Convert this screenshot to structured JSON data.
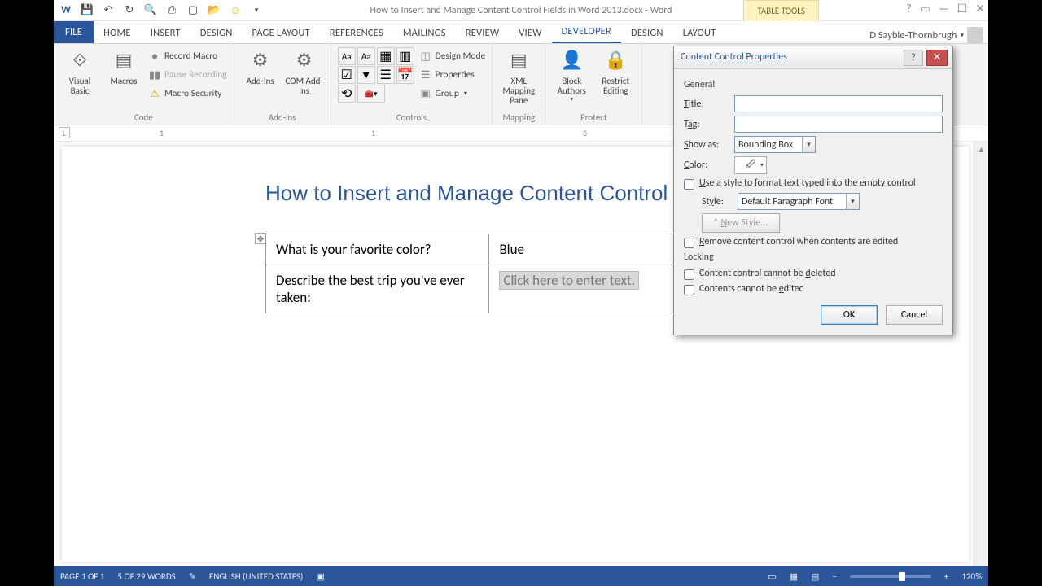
{
  "title": "How to Insert and Manage Content Control Fields in Word 2013.docx - Word",
  "context_tab": "TABLE TOOLS",
  "tabs": [
    "FILE",
    "HOME",
    "INSERT",
    "DESIGN",
    "PAGE LAYOUT",
    "REFERENCES",
    "MAILINGS",
    "REVIEW",
    "VIEW",
    "DEVELOPER",
    "DESIGN",
    "LAYOUT"
  ],
  "active_tab": "DEVELOPER",
  "user": "D Sayble-Thornbrugh",
  "ribbon": {
    "code": {
      "visual_basic": "Visual Basic",
      "macros": "Macros",
      "record": "Record Macro",
      "pause": "Pause Recording",
      "security": "Macro Security",
      "label": "Code"
    },
    "addins": {
      "addins": "Add-Ins",
      "com": "COM Add-Ins",
      "label": "Add-ins"
    },
    "controls": {
      "design": "Design Mode",
      "props": "Properties",
      "group": "Group",
      "label": "Controls"
    },
    "mapping": {
      "xml": "XML Mapping Pane",
      "label": "Mapping"
    },
    "protect": {
      "block": "Block Authors",
      "restrict": "Restrict Editing",
      "label": "Protect"
    }
  },
  "ruler": {
    "marks": [
      "1",
      "1",
      "3"
    ]
  },
  "doc": {
    "heading": "How to Insert and Manage Content Control Fields",
    "q1": "What is your favorite color?",
    "a1": "Blue",
    "q2": "Describe the best trip you've ever taken:",
    "placeholder": "Click here to enter text."
  },
  "dialog": {
    "title": "Content Control Properties",
    "general": "General",
    "title_label": "Title:",
    "tag_label": "Tag:",
    "show_as_label": "Show as:",
    "show_as_value": "Bounding Box",
    "color_label": "Color:",
    "use_style": "Use a style to format text typed into the empty control",
    "style_label": "Style:",
    "style_value": "Default Paragraph Font",
    "new_style": "New Style...",
    "remove_cc": "Remove content control when contents are edited",
    "locking": "Locking",
    "no_delete": "Content control cannot be deleted",
    "no_edit": "Contents cannot be edited",
    "ok": "OK",
    "cancel": "Cancel"
  },
  "status": {
    "page": "PAGE 1 OF 1",
    "words": "5 OF 29 WORDS",
    "lang": "ENGLISH (UNITED STATES)",
    "zoom": "120%"
  }
}
